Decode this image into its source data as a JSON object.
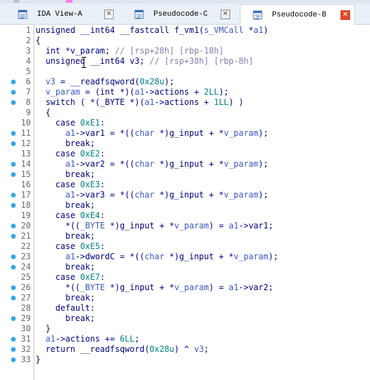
{
  "tabs": [
    {
      "label": "IDA View-A",
      "active": false,
      "icon": "text-view-icon"
    },
    {
      "label": "Pseudocode-C",
      "active": false,
      "icon": "pseudocode-icon"
    },
    {
      "label": "Pseudocode-B",
      "active": true,
      "icon": "pseudocode-icon"
    }
  ],
  "colors": {
    "accent": "#38a7e6",
    "close_active": "#e04a2a",
    "keyword": "#000080",
    "number": "#008080",
    "comment": "#7f7fb0",
    "variable": "#3b58c4"
  },
  "lines": [
    {
      "num": "1",
      "dot": false,
      "tokens": [
        [
          "k",
          "unsigned __int64 __fastcall f_vm1("
        ],
        [
          "v",
          "s_VMCall"
        ],
        [
          "k",
          " *"
        ],
        [
          "v",
          "a1"
        ],
        [
          "k",
          ")"
        ]
      ]
    },
    {
      "num": "2",
      "dot": false,
      "tokens": [
        [
          "k",
          "{"
        ]
      ]
    },
    {
      "num": "3",
      "dot": false,
      "tokens": [
        [
          "k",
          "  int *v_param; "
        ],
        [
          "c",
          "// [rsp+28h] [rbp-18h]"
        ]
      ]
    },
    {
      "num": "4",
      "dot": false,
      "tokens": [
        [
          "k",
          "  unsigned __int64 v3; "
        ],
        [
          "c",
          "// [rsp+38h] [rbp-8h]"
        ]
      ]
    },
    {
      "num": "5",
      "dot": false,
      "tokens": [
        [
          "k",
          ""
        ]
      ]
    },
    {
      "num": "6",
      "dot": true,
      "tokens": [
        [
          "v",
          "  v3"
        ],
        [
          "k",
          " = __readfsqword("
        ],
        [
          "n",
          "0x28u"
        ],
        [
          "k",
          ");"
        ]
      ]
    },
    {
      "num": "7",
      "dot": true,
      "tokens": [
        [
          "v",
          "  v_param"
        ],
        [
          "k",
          " = (int *)("
        ],
        [
          "v",
          "a1"
        ],
        [
          "k",
          "->actions + "
        ],
        [
          "n",
          "2LL"
        ],
        [
          "k",
          ");"
        ]
      ]
    },
    {
      "num": "8",
      "dot": true,
      "tokens": [
        [
          "k",
          "  switch ( *(_BYTE *)("
        ],
        [
          "v",
          "a1"
        ],
        [
          "k",
          "->actions + "
        ],
        [
          "n",
          "1LL"
        ],
        [
          "k",
          ") )"
        ]
      ]
    },
    {
      "num": "9",
      "dot": false,
      "tokens": [
        [
          "k",
          "  {"
        ]
      ]
    },
    {
      "num": "10",
      "dot": false,
      "tokens": [
        [
          "k",
          "    case "
        ],
        [
          "n",
          "0xE1"
        ],
        [
          "k",
          ":"
        ]
      ]
    },
    {
      "num": "11",
      "dot": true,
      "tokens": [
        [
          "v",
          "      a1"
        ],
        [
          "k",
          "->var1 = *(("
        ],
        [
          "t",
          "char"
        ],
        [
          "k",
          " *)g_input + *"
        ],
        [
          "v",
          "v_param"
        ],
        [
          "k",
          ");"
        ]
      ]
    },
    {
      "num": "12",
      "dot": true,
      "tokens": [
        [
          "k",
          "      break;"
        ]
      ]
    },
    {
      "num": "13",
      "dot": false,
      "tokens": [
        [
          "k",
          "    case "
        ],
        [
          "n",
          "0xE2"
        ],
        [
          "k",
          ":"
        ]
      ]
    },
    {
      "num": "14",
      "dot": true,
      "tokens": [
        [
          "v",
          "      a1"
        ],
        [
          "k",
          "->var2 = *(("
        ],
        [
          "t",
          "char"
        ],
        [
          "k",
          " *)g_input + *"
        ],
        [
          "v",
          "v_param"
        ],
        [
          "k",
          ");"
        ]
      ]
    },
    {
      "num": "15",
      "dot": true,
      "tokens": [
        [
          "k",
          "      break;"
        ]
      ]
    },
    {
      "num": "16",
      "dot": false,
      "tokens": [
        [
          "k",
          "    case "
        ],
        [
          "n",
          "0xE3"
        ],
        [
          "k",
          ":"
        ]
      ]
    },
    {
      "num": "17",
      "dot": true,
      "tokens": [
        [
          "v",
          "      a1"
        ],
        [
          "k",
          "->var3 = *(("
        ],
        [
          "t",
          "char"
        ],
        [
          "k",
          " *)g_input + *"
        ],
        [
          "v",
          "v_param"
        ],
        [
          "k",
          ");"
        ]
      ]
    },
    {
      "num": "18",
      "dot": true,
      "tokens": [
        [
          "k",
          "      break;"
        ]
      ]
    },
    {
      "num": "19",
      "dot": false,
      "tokens": [
        [
          "k",
          "    case "
        ],
        [
          "n",
          "0xE4"
        ],
        [
          "k",
          ":"
        ]
      ]
    },
    {
      "num": "20",
      "dot": true,
      "tokens": [
        [
          "k",
          "      *(("
        ],
        [
          "t",
          "_BYTE"
        ],
        [
          "k",
          " *)g_input + *"
        ],
        [
          "v",
          "v_param"
        ],
        [
          "k",
          ") = "
        ],
        [
          "v",
          "a1"
        ],
        [
          "k",
          "->var1;"
        ]
      ]
    },
    {
      "num": "21",
      "dot": true,
      "tokens": [
        [
          "k",
          "      break;"
        ]
      ]
    },
    {
      "num": "22",
      "dot": false,
      "tokens": [
        [
          "k",
          "    case "
        ],
        [
          "n",
          "0xE5"
        ],
        [
          "k",
          ":"
        ]
      ]
    },
    {
      "num": "23",
      "dot": true,
      "tokens": [
        [
          "v",
          "      a1"
        ],
        [
          "k",
          "->dwordC = *(("
        ],
        [
          "t",
          "char"
        ],
        [
          "k",
          " *)g_input + *"
        ],
        [
          "v",
          "v_param"
        ],
        [
          "k",
          ");"
        ]
      ]
    },
    {
      "num": "24",
      "dot": true,
      "tokens": [
        [
          "k",
          "      break;"
        ]
      ]
    },
    {
      "num": "25",
      "dot": false,
      "tokens": [
        [
          "k",
          "    case "
        ],
        [
          "n",
          "0xE7"
        ],
        [
          "k",
          ":"
        ]
      ]
    },
    {
      "num": "26",
      "dot": true,
      "tokens": [
        [
          "k",
          "      *(("
        ],
        [
          "t",
          "_BYTE"
        ],
        [
          "k",
          " *)g_input + *"
        ],
        [
          "v",
          "v_param"
        ],
        [
          "k",
          ") = "
        ],
        [
          "v",
          "a1"
        ],
        [
          "k",
          "->var2;"
        ]
      ]
    },
    {
      "num": "27",
      "dot": true,
      "tokens": [
        [
          "k",
          "      break;"
        ]
      ]
    },
    {
      "num": "28",
      "dot": false,
      "tokens": [
        [
          "k",
          "    default:"
        ]
      ]
    },
    {
      "num": "29",
      "dot": true,
      "tokens": [
        [
          "k",
          "      break;"
        ]
      ]
    },
    {
      "num": "30",
      "dot": false,
      "tokens": [
        [
          "k",
          "  }"
        ]
      ]
    },
    {
      "num": "31",
      "dot": true,
      "tokens": [
        [
          "v",
          "  a1"
        ],
        [
          "k",
          "->actions += "
        ],
        [
          "n",
          "6LL"
        ],
        [
          "k",
          ";"
        ]
      ]
    },
    {
      "num": "32",
      "dot": true,
      "tokens": [
        [
          "k",
          "  return __readfsqword("
        ],
        [
          "n",
          "0x28u"
        ],
        [
          "k",
          ") ^ "
        ],
        [
          "v",
          "v3"
        ],
        [
          "k",
          ";"
        ]
      ]
    },
    {
      "num": "33",
      "dot": true,
      "tokens": [
        [
          "k",
          "}"
        ]
      ]
    }
  ]
}
